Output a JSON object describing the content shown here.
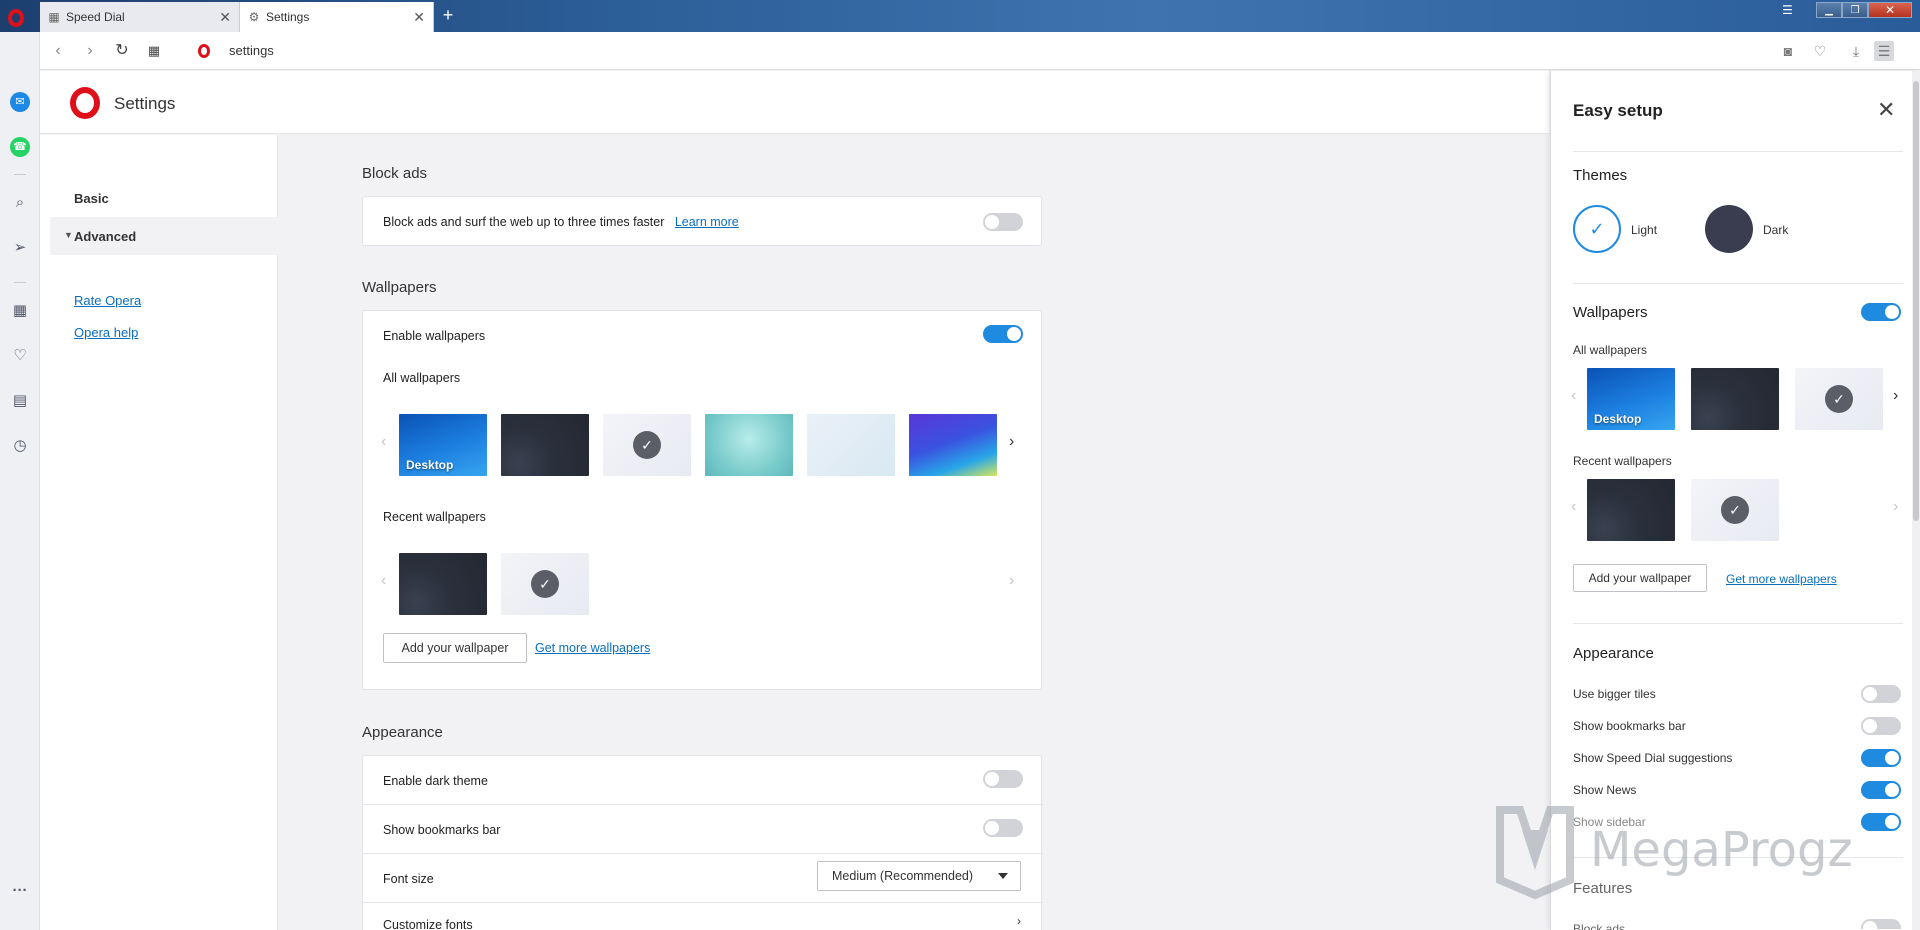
{
  "tabs": [
    {
      "label": "Speed Dial",
      "icon": "grid-icon"
    },
    {
      "label": "Settings",
      "icon": "gear-icon"
    }
  ],
  "address_bar": {
    "url": "settings"
  },
  "page": {
    "title": "Settings"
  },
  "left_nav": {
    "basic": "Basic",
    "advanced": "Advanced",
    "links": [
      "Rate Opera",
      "Opera help"
    ]
  },
  "block_ads": {
    "section": "Block ads",
    "description": "Block ads and surf the web up to three times faster",
    "learn_more": "Learn more",
    "enabled": false
  },
  "wallpapers": {
    "section": "Wallpapers",
    "enable_label": "Enable wallpapers",
    "enabled": true,
    "all_label": "All wallpapers",
    "desktop_label": "Desktop",
    "recent_label": "Recent wallpapers",
    "add_button": "Add your wallpaper",
    "get_more": "Get more wallpapers"
  },
  "appearance": {
    "section": "Appearance",
    "rows": [
      {
        "label": "Enable dark theme",
        "enabled": false
      },
      {
        "label": "Show bookmarks bar",
        "enabled": false
      }
    ],
    "font_size_label": "Font size",
    "font_size_value": "Medium (Recommended)",
    "customize_fonts": "Customize fonts"
  },
  "easy_setup": {
    "title": "Easy setup",
    "themes_heading": "Themes",
    "theme_light": "Light",
    "theme_dark": "Dark",
    "wallpapers_heading": "Wallpapers",
    "wallpapers_enabled": true,
    "all_label": "All wallpapers",
    "desktop_label": "Desktop",
    "recent_label": "Recent wallpapers",
    "add_button": "Add your wallpaper",
    "get_more": "Get more wallpapers",
    "appearance_heading": "Appearance",
    "appearance_rows": [
      {
        "label": "Use bigger tiles",
        "enabled": false
      },
      {
        "label": "Show bookmarks bar",
        "enabled": false
      },
      {
        "label": "Show Speed Dial suggestions",
        "enabled": true
      },
      {
        "label": "Show News",
        "enabled": true
      },
      {
        "label": "Show sidebar",
        "enabled": true
      }
    ],
    "features_heading": "Features",
    "features_first": "Block ads"
  },
  "watermark": "MegaProgz",
  "colors": {
    "accent": "#1e8ae0",
    "opera_red": "#e0101a",
    "link": "#0a6ebd"
  }
}
